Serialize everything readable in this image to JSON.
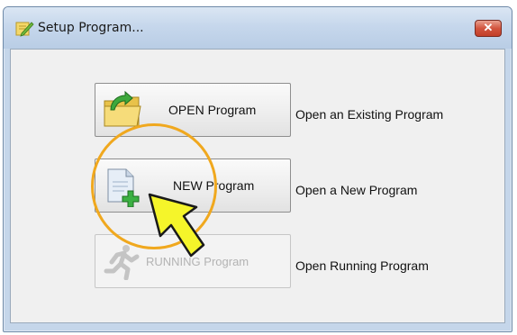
{
  "window": {
    "title": "Setup Program...",
    "close_label": "✕"
  },
  "buttons": [
    {
      "label": "OPEN Program",
      "description": "Open an Existing Program",
      "enabled": true,
      "icon": "open-folder-icon"
    },
    {
      "label": "NEW Program",
      "description": "Open a New Program",
      "enabled": true,
      "icon": "new-document-icon"
    },
    {
      "label": "RUNNING Program",
      "description": "Open Running Program",
      "enabled": false,
      "icon": "running-man-icon"
    }
  ],
  "colors": {
    "highlight_ring": "#f0a81e",
    "pointer_arrow": "#f5f52a",
    "titlebar": "#c6d7ec",
    "close_button": "#d2553f"
  }
}
